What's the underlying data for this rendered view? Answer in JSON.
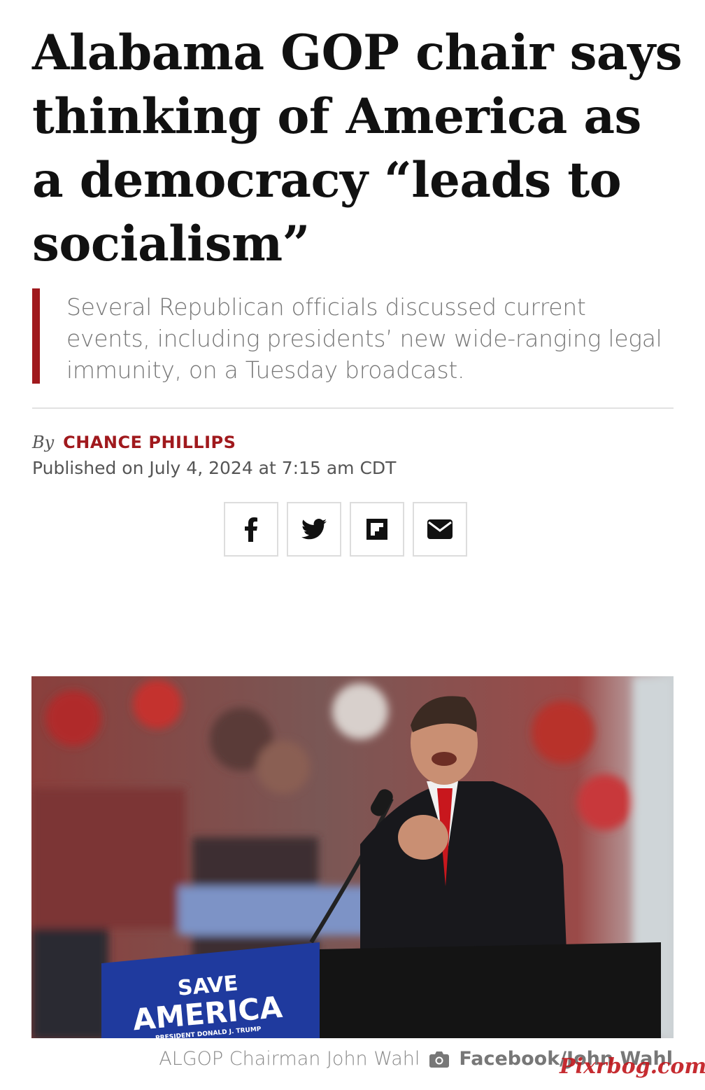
{
  "article": {
    "headline": "Alabama GOP chair says thinking of America as a democracy “leads to socialism”",
    "deck": "Several Republican officials discussed current events, including presidents’ new wide-ranging legal immunity, on a Tuesday broadcast.",
    "byline_prefix": "By",
    "author": "CHANCE PHILLIPS",
    "published": "Published on July 4, 2024 at 7:15 am CDT"
  },
  "share": [
    {
      "name": "facebook",
      "icon": "facebook-icon"
    },
    {
      "name": "twitter",
      "icon": "twitter-icon"
    },
    {
      "name": "flipboard",
      "icon": "flipboard-icon"
    },
    {
      "name": "email",
      "icon": "envelope-icon"
    }
  ],
  "photo": {
    "sign_line1": "SAVE",
    "sign_line2": "AMERICA",
    "sign_line3": "PRESIDENT DONALD J. TRUMP",
    "caption": "ALGOP Chairman John Wahl",
    "credit": "Facebook/John Wahl"
  },
  "watermark": "Pixrbog.com",
  "colors": {
    "accent": "#a0191d",
    "deck_text": "#777777",
    "sign_blue": "#1f3a9e"
  }
}
